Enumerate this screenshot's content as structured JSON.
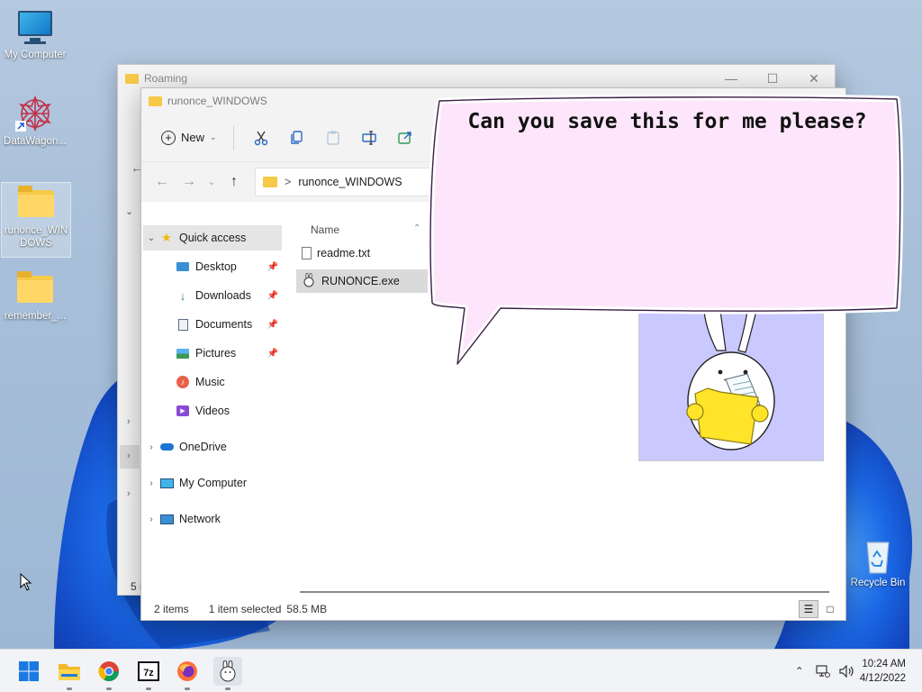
{
  "desktop": {
    "icons": [
      {
        "label": "My Computer"
      },
      {
        "label": "DataWagon..."
      },
      {
        "label": "runonce_WIN\nDOWS"
      },
      {
        "label": "remember_..."
      },
      {
        "label": "Recycle Bin"
      }
    ]
  },
  "back_window": {
    "title": "Roaming",
    "status_fragment": "5 i"
  },
  "window": {
    "title": "runonce_WINDOWS",
    "toolbar": {
      "new_label": "New"
    },
    "address": {
      "separator": ">",
      "path": "runonce_WINDOWS"
    },
    "sidebar": [
      {
        "label": "Quick access",
        "icon": "star-icon"
      },
      {
        "label": "Desktop",
        "icon": "desktop-icon",
        "pinned": true
      },
      {
        "label": "Downloads",
        "icon": "download-icon",
        "pinned": true
      },
      {
        "label": "Documents",
        "icon": "documents-icon",
        "pinned": true
      },
      {
        "label": "Pictures",
        "icon": "pictures-icon",
        "pinned": true
      },
      {
        "label": "Music",
        "icon": "music-icon"
      },
      {
        "label": "Videos",
        "icon": "videos-icon"
      },
      {
        "label": "OneDrive",
        "icon": "cloud-icon"
      },
      {
        "label": "My Computer",
        "icon": "computer-icon"
      },
      {
        "label": "Network",
        "icon": "network-icon"
      }
    ],
    "columns": {
      "name": "Name"
    },
    "files": [
      {
        "name": "readme.txt",
        "icon": "text-file-icon"
      },
      {
        "name": "RUNONCE.exe",
        "icon": "exe-icon",
        "selected": true
      }
    ],
    "status": {
      "count": "2 items",
      "selection": "1 item selected",
      "size": "58.5 MB"
    }
  },
  "bubble": {
    "text": "Can you save this for me please?"
  },
  "taskbar": {
    "apps": [
      "start-icon",
      "file-explorer-icon",
      "chrome-icon",
      "7zip-icon",
      "firefox-icon",
      "bunny-app-icon"
    ],
    "time": "10:24 AM",
    "date": "4/12/2022"
  },
  "colors": {
    "accent": "#0067c0",
    "folder": "#f7c948",
    "bubble_fill": "#fde6fb",
    "preview_bg": "#c9c8ff"
  }
}
